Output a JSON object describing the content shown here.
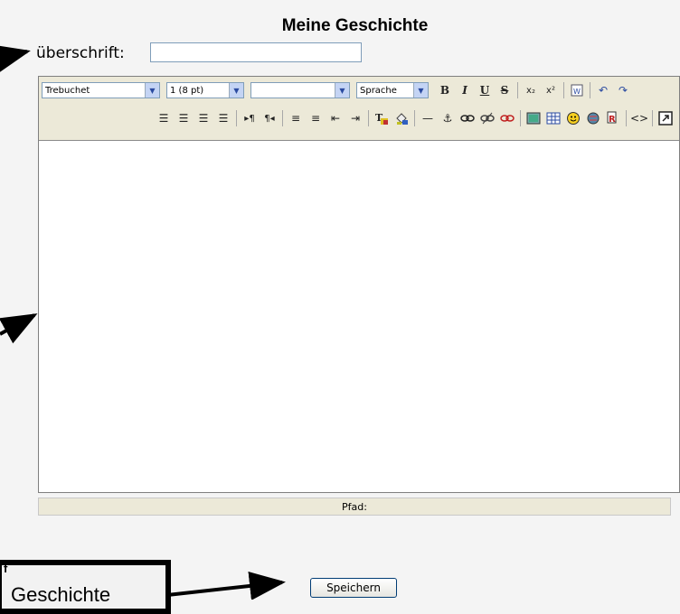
{
  "page": {
    "title": "Meine Geschichte"
  },
  "heading": {
    "label": "überschrift:",
    "value": ""
  },
  "toolbar": {
    "font_family": "Trebuchet",
    "font_size": "1 (8 pt)",
    "format": "",
    "language": "Sprache",
    "bold": "B",
    "italic": "I",
    "underline": "U",
    "strike": "S",
    "row1_icons": [
      "subscript-icon",
      "superscript-icon",
      "paste-word-icon",
      "undo-icon",
      "redo-icon"
    ],
    "row2_icons": [
      "align-left-icon",
      "align-center-icon",
      "align-right-icon",
      "justify-icon",
      "ltr-icon",
      "rtl-icon",
      "ordered-list-icon",
      "unordered-list-icon",
      "outdent-icon",
      "indent-icon",
      "text-color-icon",
      "background-color-icon",
      "horizontal-rule-icon",
      "anchor-icon",
      "link-icon",
      "unlink-icon",
      "nolink-icon",
      "image-icon",
      "table-icon",
      "emoticon-icon",
      "spellcheck-icon",
      "search-replace-icon",
      "html-source-icon",
      "fullscreen-icon"
    ]
  },
  "editor": {
    "content": ""
  },
  "pathbar": {
    "label": "Pfad:"
  },
  "save_button": {
    "label": "Speichern"
  },
  "callout": {
    "letter": "f",
    "text": "Geschichte"
  },
  "colors": {
    "toolbar_bg": "#ece9d8",
    "select_arrow": "#c4d4f4",
    "border": "#7f9db9"
  }
}
